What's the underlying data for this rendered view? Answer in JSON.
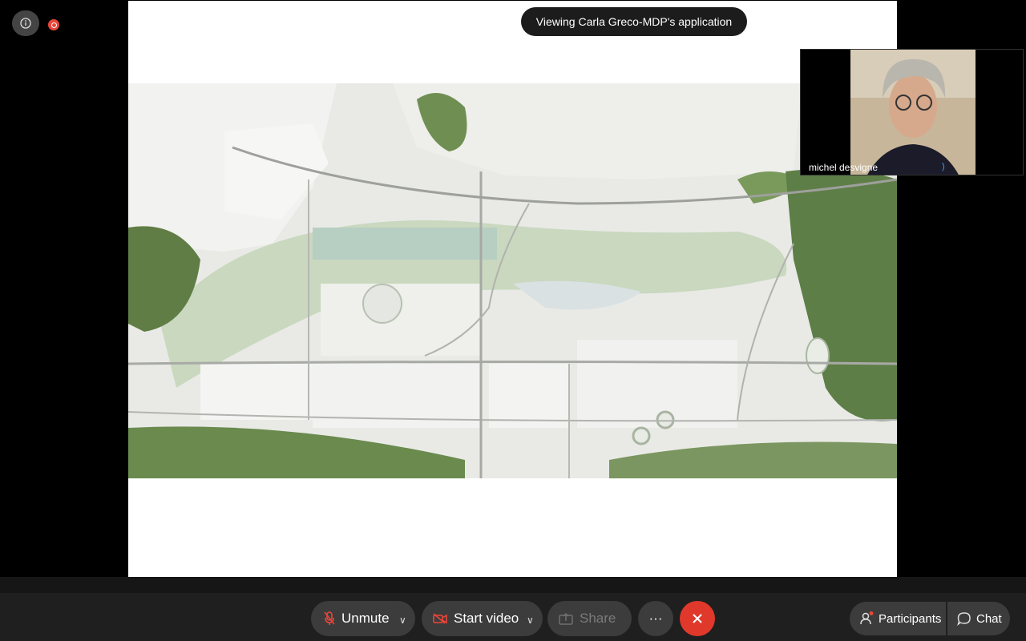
{
  "top_controls": {
    "info_icon": "info-icon",
    "recording_icon": "recording-icon"
  },
  "share": {
    "banner_text": "Viewing Carla Greco-MDP's application"
  },
  "self_view": {
    "name": "michel desvigne"
  },
  "toolbar": {
    "unmute_label": "Unmute",
    "start_video_label": "Start video",
    "share_label": "Share",
    "more_label": "···",
    "participants_label": "Participants",
    "chat_label": "Chat"
  },
  "colors": {
    "leave": "#e0392b",
    "mic_muted": "#e8463a",
    "notification_dot": "#e8463a"
  }
}
